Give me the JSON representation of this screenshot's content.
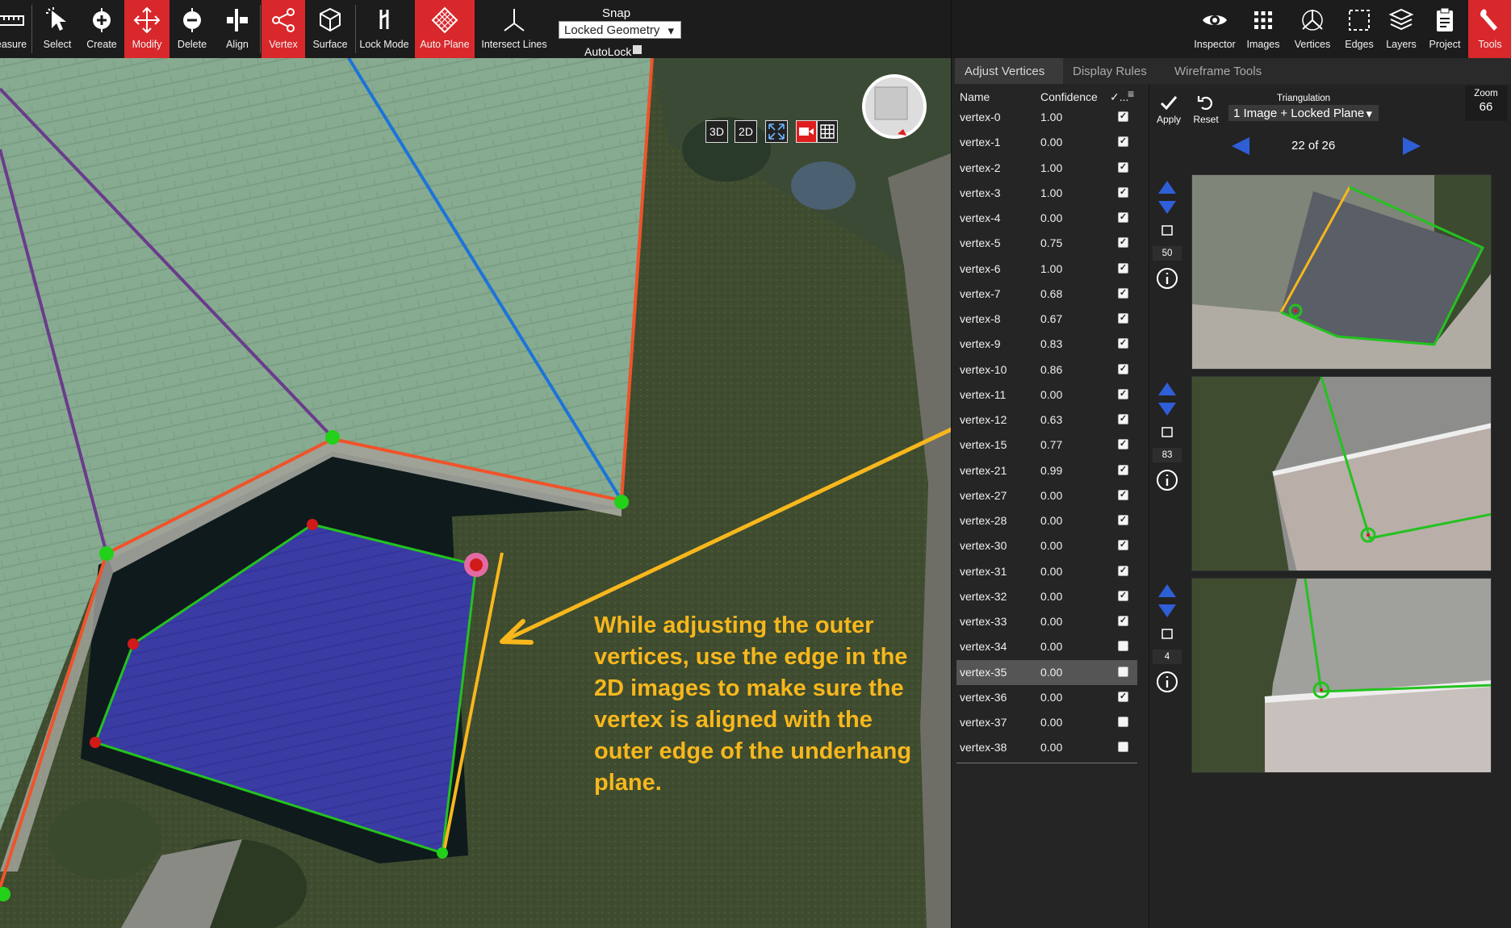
{
  "toolbar": {
    "tools": [
      {
        "id": "measure",
        "label": "easure",
        "icon": "ruler-icon"
      },
      {
        "id": "select",
        "label": "Select",
        "icon": "cursor-icon"
      },
      {
        "id": "create",
        "label": "Create",
        "icon": "create-plus-icon"
      },
      {
        "id": "modify",
        "label": "Modify",
        "icon": "move-arrows-icon"
      },
      {
        "id": "delete",
        "label": "Delete",
        "icon": "delete-minus-icon"
      },
      {
        "id": "align",
        "label": "Align",
        "icon": "align-icon"
      },
      {
        "id": "vertex",
        "label": "Vertex",
        "icon": "vertex-share-icon"
      },
      {
        "id": "surface",
        "label": "Surface",
        "icon": "cube-icon"
      },
      {
        "id": "lock-mode",
        "label": "Lock Mode",
        "icon": "lock-mode-icon"
      },
      {
        "id": "auto-plane",
        "label": "Auto Plane",
        "icon": "grid-diamond-icon"
      },
      {
        "id": "intersect-lines",
        "label": "Intersect Lines",
        "icon": "intersect-icon"
      }
    ],
    "active_tools": [
      "modify",
      "vertex",
      "auto-plane"
    ],
    "snap": {
      "title": "Snap",
      "selected": "Locked Geometry",
      "autolock_label": "AutoLock"
    }
  },
  "right_tools": [
    {
      "id": "inspector",
      "label": "Inspector",
      "icon": "eye-icon"
    },
    {
      "id": "images",
      "label": "Images",
      "icon": "grid-dots-icon"
    },
    {
      "id": "vertices",
      "label": "Vertices",
      "icon": "vertices-icon"
    },
    {
      "id": "edges",
      "label": "Edges",
      "icon": "edges-icon"
    },
    {
      "id": "layers",
      "label": "Layers",
      "icon": "layers-icon"
    },
    {
      "id": "project",
      "label": "Project",
      "icon": "clipboard-icon"
    },
    {
      "id": "tools",
      "label": "Tools",
      "icon": "wrench-icon"
    }
  ],
  "viewport": {
    "view_buttons": {
      "b3d": "3D",
      "b2d": "2D"
    },
    "annotation": "While adjusting the outer vertices, use the edge in the 2D images to make sure the vertex is aligned with the outer edge of the underhang plane."
  },
  "tabs": [
    {
      "label": "Adjust Vertices",
      "active": true
    },
    {
      "label": "Display Rules",
      "active": false
    },
    {
      "label": "Wireframe Tools",
      "active": false
    }
  ],
  "vertex_table": {
    "headers": {
      "name": "Name",
      "confidence": "Confidence",
      "check": "✓..."
    },
    "rows": [
      {
        "name": "vertex-0",
        "confidence": "1.00",
        "checked": true
      },
      {
        "name": "vertex-1",
        "confidence": "0.00",
        "checked": true
      },
      {
        "name": "vertex-2",
        "confidence": "1.00",
        "checked": true
      },
      {
        "name": "vertex-3",
        "confidence": "1.00",
        "checked": true
      },
      {
        "name": "vertex-4",
        "confidence": "0.00",
        "checked": true
      },
      {
        "name": "vertex-5",
        "confidence": "0.75",
        "checked": true
      },
      {
        "name": "vertex-6",
        "confidence": "1.00",
        "checked": true
      },
      {
        "name": "vertex-7",
        "confidence": "0.68",
        "checked": true
      },
      {
        "name": "vertex-8",
        "confidence": "0.67",
        "checked": true
      },
      {
        "name": "vertex-9",
        "confidence": "0.83",
        "checked": true
      },
      {
        "name": "vertex-10",
        "confidence": "0.86",
        "checked": true
      },
      {
        "name": "vertex-11",
        "confidence": "0.00",
        "checked": true
      },
      {
        "name": "vertex-12",
        "confidence": "0.63",
        "checked": true
      },
      {
        "name": "vertex-15",
        "confidence": "0.77",
        "checked": true
      },
      {
        "name": "vertex-21",
        "confidence": "0.99",
        "checked": true
      },
      {
        "name": "vertex-27",
        "confidence": "0.00",
        "checked": true
      },
      {
        "name": "vertex-28",
        "confidence": "0.00",
        "checked": true
      },
      {
        "name": "vertex-30",
        "confidence": "0.00",
        "checked": true
      },
      {
        "name": "vertex-31",
        "confidence": "0.00",
        "checked": true
      },
      {
        "name": "vertex-32",
        "confidence": "0.00",
        "checked": true
      },
      {
        "name": "vertex-33",
        "confidence": "0.00",
        "checked": true
      },
      {
        "name": "vertex-34",
        "confidence": "0.00",
        "checked": false
      },
      {
        "name": "vertex-35",
        "confidence": "0.00",
        "checked": false,
        "selected": true
      },
      {
        "name": "vertex-36",
        "confidence": "0.00",
        "checked": true
      },
      {
        "name": "vertex-37",
        "confidence": "0.00",
        "checked": false
      },
      {
        "name": "vertex-38",
        "confidence": "0.00",
        "checked": false
      }
    ]
  },
  "image_panel": {
    "apply_label": "Apply",
    "reset_label": "Reset",
    "triangulation": {
      "title": "Triangulation",
      "selected": "1 Image + Locked Plane"
    },
    "zoom": {
      "title": "Zoom",
      "value": "66"
    },
    "pager": {
      "text": "22 of 26"
    },
    "thumbnails": [
      {
        "count": "50"
      },
      {
        "count": "83"
      },
      {
        "count": "4"
      }
    ]
  },
  "colors": {
    "accent_red": "#d9282b",
    "annotation_yellow": "#f7b71d",
    "edge_green": "#23c21f",
    "edge_orange": "#f0532a",
    "selected_plane_blue": "#3a3aa0"
  }
}
